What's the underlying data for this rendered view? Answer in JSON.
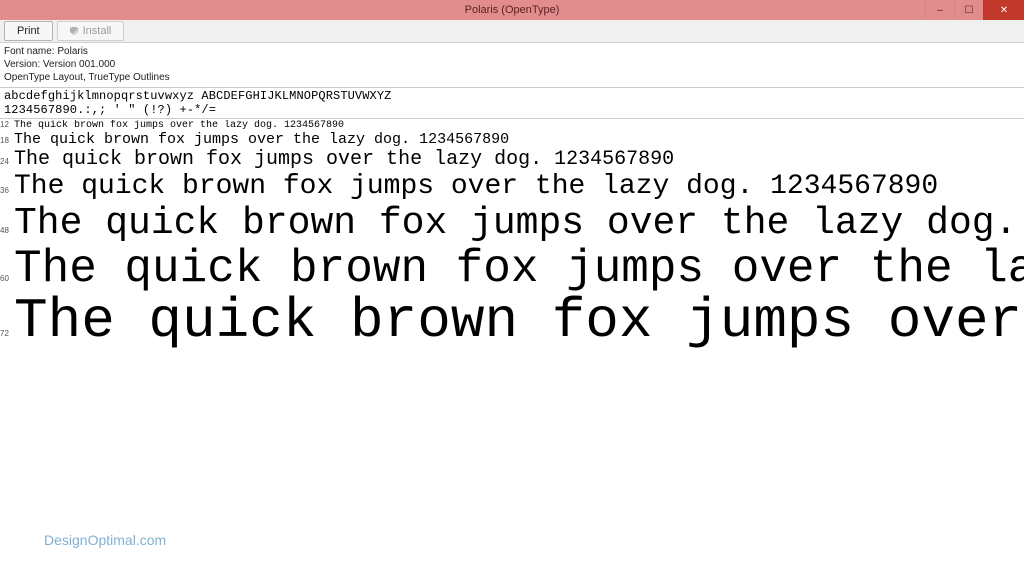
{
  "window": {
    "title": "Polaris (OpenType)"
  },
  "toolbar": {
    "print_label": "Print",
    "install_label": "Install"
  },
  "meta": {
    "font_name_label": "Font name: ",
    "font_name": "Polaris",
    "version_label": "Version: ",
    "version": "Version 001.000",
    "outline_info": "OpenType Layout, TrueType Outlines"
  },
  "sample": {
    "alpha": "abcdefghijklmnopqrstuvwxyz ABCDEFGHIJKLMNOPQRSTUVWXYZ",
    "nums": "1234567890.:,; ' \" (!?) +-*/=",
    "pangram": "The quick brown fox jumps over the lazy dog. 1234567890",
    "sizes": [
      "12",
      "18",
      "24",
      "36",
      "48",
      "60",
      "72"
    ]
  },
  "watermark": "DesignOptimal.com"
}
